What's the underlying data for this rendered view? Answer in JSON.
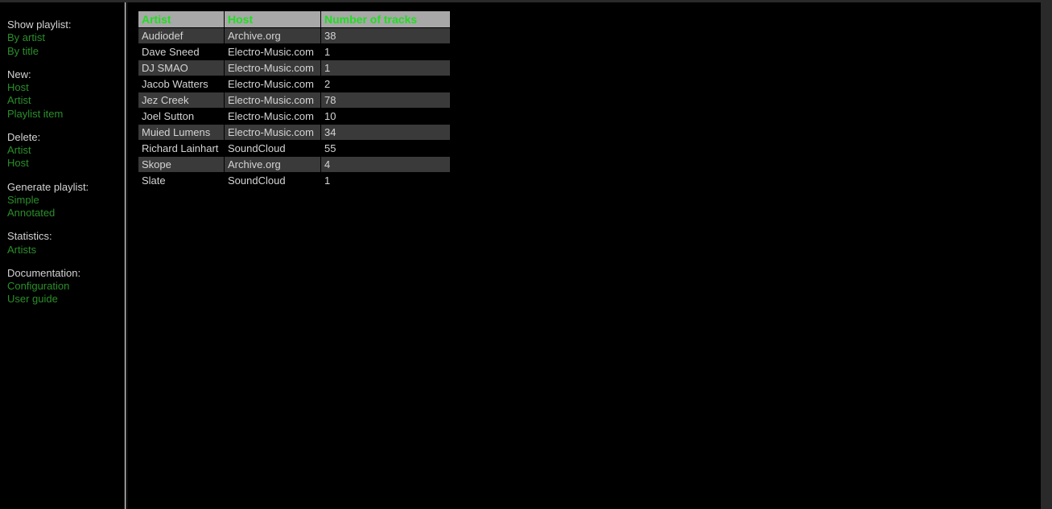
{
  "sidebar": {
    "show_playlist": {
      "label": "Show playlist:",
      "by_artist": "By artist",
      "by_title": "By title"
    },
    "new_section": {
      "label": "New:",
      "host": "Host",
      "artist": "Artist",
      "playlist_item": "Playlist item"
    },
    "delete_section": {
      "label": "Delete:",
      "artist": "Artist",
      "host": "Host"
    },
    "generate_playlist": {
      "label": "Generate playlist:",
      "simple": "Simple",
      "annotated": "Annotated"
    },
    "statistics": {
      "label": "Statistics:",
      "artists": "Artists"
    },
    "documentation": {
      "label": "Documentation:",
      "configuration": "Configuration",
      "user_guide": "User guide"
    }
  },
  "table": {
    "headers": {
      "artist": "Artist",
      "host": "Host",
      "tracks": "Number of tracks"
    },
    "rows": [
      {
        "artist": "Audiodef",
        "host": "Archive.org",
        "tracks": "38"
      },
      {
        "artist": "Dave Sneed",
        "host": "Electro-Music.com",
        "tracks": "1"
      },
      {
        "artist": "DJ SMAO",
        "host": "Electro-Music.com",
        "tracks": "1"
      },
      {
        "artist": "Jacob Watters",
        "host": "Electro-Music.com",
        "tracks": "2"
      },
      {
        "artist": "Jez Creek",
        "host": "Electro-Music.com",
        "tracks": "78"
      },
      {
        "artist": "Joel Sutton",
        "host": "Electro-Music.com",
        "tracks": "10"
      },
      {
        "artist": "Muied Lumens",
        "host": "Electro-Music.com",
        "tracks": "34"
      },
      {
        "artist": "Richard Lainhart",
        "host": "SoundCloud",
        "tracks": "55"
      },
      {
        "artist": "Skope",
        "host": "Archive.org",
        "tracks": "4"
      },
      {
        "artist": "Slate",
        "host": "SoundCloud",
        "tracks": "1"
      }
    ]
  }
}
